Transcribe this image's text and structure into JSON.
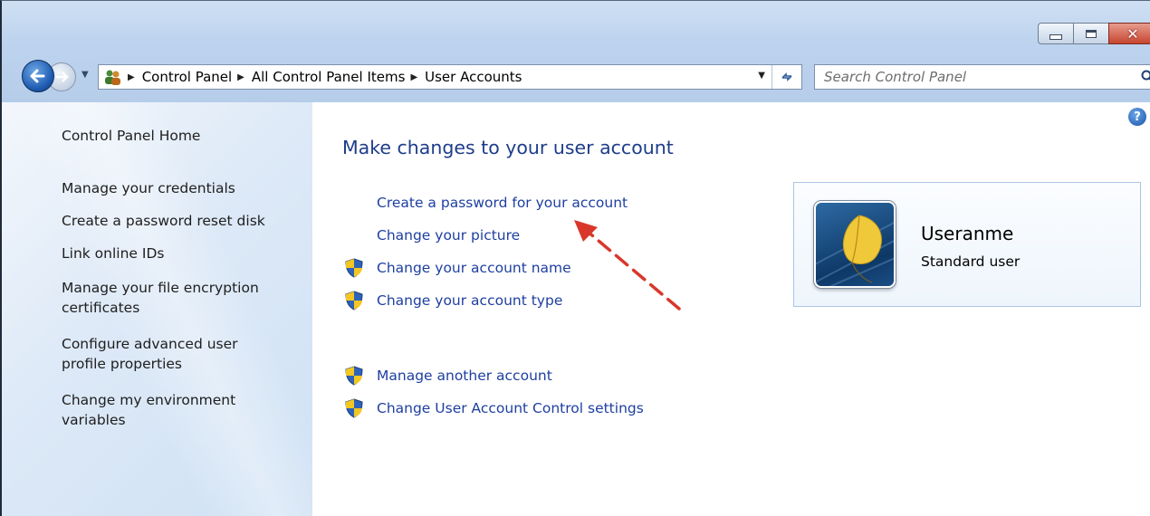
{
  "breadcrumb": [
    "Control Panel",
    "All Control Panel Items",
    "User Accounts"
  ],
  "search": {
    "placeholder": "Search Control Panel"
  },
  "sidebar": {
    "home": "Control Panel Home",
    "items": [
      {
        "label": "Manage your credentials"
      },
      {
        "label": "Create a password reset disk"
      },
      {
        "label": "Link online IDs"
      },
      {
        "label": "Manage your file encryption certificates"
      },
      {
        "label": "Configure advanced user profile properties"
      },
      {
        "label": "Change my environment variables"
      }
    ]
  },
  "main": {
    "title": "Make changes to your user account",
    "tasks": [
      {
        "label": "Create a password for your account",
        "shield": false
      },
      {
        "label": "Change your picture",
        "shield": false
      },
      {
        "label": "Change your account name",
        "shield": true
      },
      {
        "label": "Change your account type",
        "shield": true
      }
    ],
    "other_tasks": [
      {
        "label": "Manage another account",
        "shield": true
      },
      {
        "label": "Change User Account Control settings",
        "shield": true
      }
    ]
  },
  "account": {
    "name": "Useranme",
    "type": "Standard user"
  },
  "icons": {
    "back": "back-arrow-icon",
    "forward": "forward-arrow-icon",
    "search": "search-icon",
    "help": "help-icon",
    "shield": "uac-shield-icon",
    "users": "user-accounts-icon",
    "refresh": "refresh-icon"
  },
  "colors": {
    "link": "#1e3fa0",
    "title": "#1e3d8a",
    "annotation_arrow": "#d9372b"
  }
}
